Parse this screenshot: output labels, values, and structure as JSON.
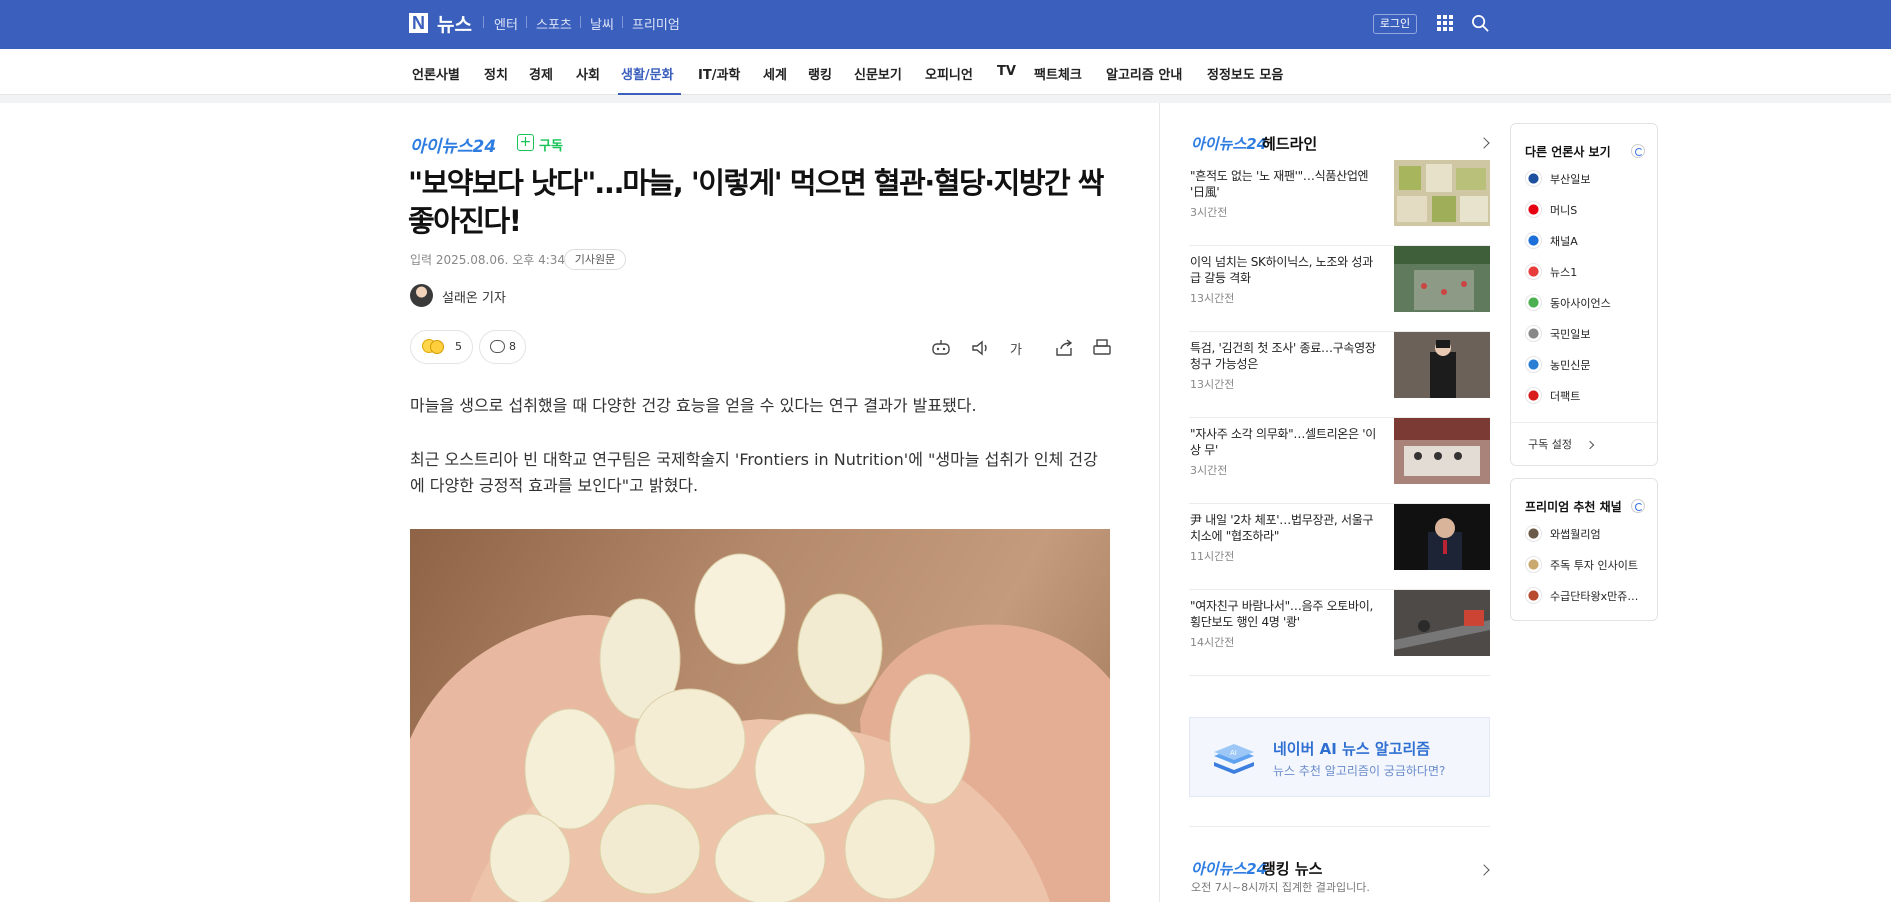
{
  "header": {
    "logo_mark": "N",
    "logo_text": "뉴스",
    "services": [
      "엔터",
      "스포츠",
      "날씨",
      "프리미엄"
    ],
    "login": "로그인"
  },
  "nav": {
    "items": [
      "언론사별",
      "정치",
      "경제",
      "사회",
      "생활/문화",
      "IT/과학",
      "세계",
      "랭킹",
      "신문보기",
      "오피니언",
      "TV",
      "팩트체크",
      "알고리즘 안내",
      "정정보도 모음"
    ],
    "active": "생활/문화"
  },
  "article": {
    "publisher": "아이뉴스24",
    "subscribe": "구독",
    "title": "\"보약보다 낫다\"…마늘, '이렇게' 먹으면 혈관·혈당·지방간 싹 좋아진다!",
    "input_date": "입력 2025.08.06. 오후 4:34",
    "original_link": "기사원문",
    "reporter": "설래온 기자",
    "reaction_count": "5",
    "comment_count": "8",
    "font_size_label": "가",
    "paragraphs": [
      "마늘을 생으로 섭취했을 때 다양한 건강 효능을 얻을 수 있다는 연구 결과가 발표됐다.",
      "최근 오스트리아 빈 대학교 연구팀은 국제학술지 'Frontiers in Nutrition'에 \"생마늘 섭취가 인체 건강에 다양한 긍정적 효과를 보인다\"고 밝혔다."
    ]
  },
  "headlines": {
    "publisher": "아이뉴스24",
    "label": "헤드라인",
    "items": [
      {
        "title": "\"흔적도 없는 '노 재팬'\"…식품산업엔 '日風'",
        "time": "3시간전"
      },
      {
        "title": "이익 넘치는 SK하이닉스, 노조와 성과급 갈등 격화",
        "time": "13시간전"
      },
      {
        "title": "특검, '김건희 첫 조사' 종료…구속영장 청구 가능성은",
        "time": "13시간전"
      },
      {
        "title": "\"자사주 소각 의무화\"…셀트리온은 '이상 무'",
        "time": "3시간전"
      },
      {
        "title": "尹 내일 '2차 체포'…법무장관, 서울구치소에 \"협조하라\"",
        "time": "11시간전"
      },
      {
        "title": "\"여자친구 바람나서\"…음주 오토바이, 횡단보도 행인 4명 '쾅'",
        "time": "14시간전"
      }
    ]
  },
  "ai_banner": {
    "title": "네이버 AI 뉴스 알고리즘",
    "subtitle": "뉴스 추천 알고리즘이 궁금하다면?"
  },
  "ranking": {
    "publisher": "아이뉴스24",
    "label": "랭킹 뉴스",
    "subtitle": "오전 7시~8시까지 집계한 결과입니다."
  },
  "other_press": {
    "title": "다른 언론사 보기",
    "items": [
      {
        "name": "부산일보",
        "color": "#1e50a0"
      },
      {
        "name": "머니S",
        "color": "#e60012"
      },
      {
        "name": "채널A",
        "color": "#1e6fd9"
      },
      {
        "name": "뉴스1",
        "color": "#e83b3b"
      },
      {
        "name": "동아사이언스",
        "color": "#4caf50"
      },
      {
        "name": "국민일보",
        "color": "#888888"
      },
      {
        "name": "농민신문",
        "color": "#2a7fd4"
      },
      {
        "name": "더팩트",
        "color": "#d91c1c"
      }
    ],
    "setting": "구독 설정"
  },
  "premium": {
    "title": "프리미엄 추천 채널",
    "items": [
      {
        "name": "와썹월리엄",
        "color": "#6b5a48"
      },
      {
        "name": "주독 투자 인사이트",
        "color": "#c9a96e"
      },
      {
        "name": "수급단타왕x만쥬…",
        "color": "#b84a2d"
      }
    ]
  },
  "colors": {
    "brand": "#3b5fbd",
    "publisher_blue": "#2f7de1",
    "subscribe_green": "#19c356"
  }
}
